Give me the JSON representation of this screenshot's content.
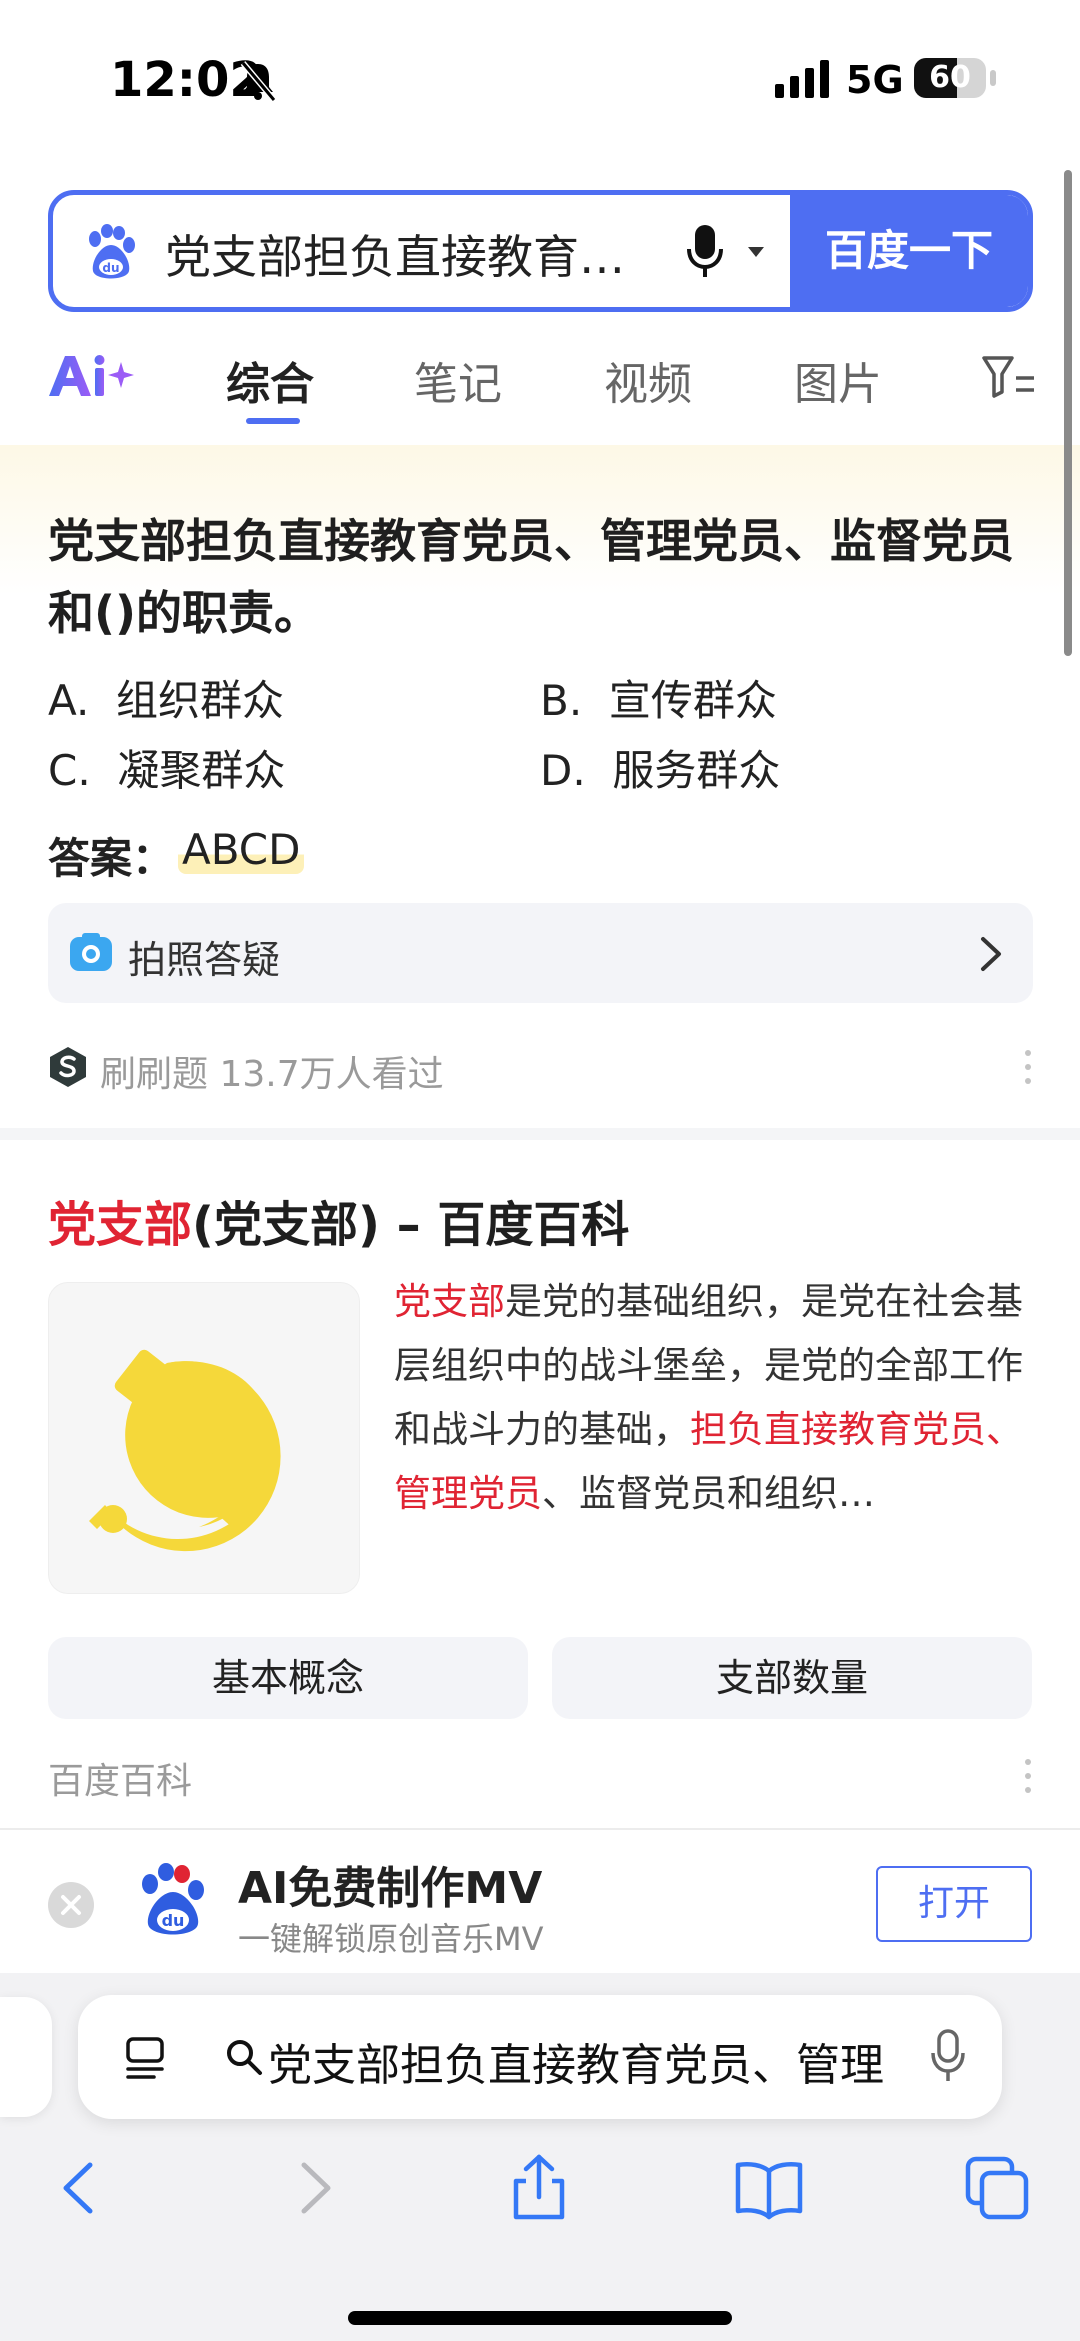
{
  "status_bar": {
    "time": "12:02",
    "network": "5G",
    "battery": "60",
    "battery_level_percent": 60
  },
  "search": {
    "query": "党支部担负直接教育…",
    "button_label": "百度一下"
  },
  "tabs": [
    {
      "label": "综合",
      "active": true
    },
    {
      "label": "笔记",
      "active": false
    },
    {
      "label": "视频",
      "active": false
    },
    {
      "label": "图片",
      "active": false
    }
  ],
  "answer_card": {
    "question": "党支部担负直接教育党员、管理党员、监督党员和()的职责。",
    "options": [
      {
        "letter": "A.",
        "text": "组织群众"
      },
      {
        "letter": "B.",
        "text": "宣传群众"
      },
      {
        "letter": "C.",
        "text": "凝聚群众"
      },
      {
        "letter": "D.",
        "text": "服务群众"
      }
    ],
    "answer_label": "答案：",
    "answer_value": "ABCD",
    "photo_qa_label": "拍照答疑",
    "source": "刷刷题 13.7万人看过"
  },
  "baike_card": {
    "title_highlight": "党支部",
    "title_rest": "(党支部) – 百度百科",
    "desc_highlight_1": "党支部",
    "desc_text_1": "是党的基础组织，是党在社会基层组织中的战斗堡垒，是党的全部工作和战斗力的基础，",
    "desc_highlight_2": "担负直接教育党员、管理党员",
    "desc_text_2": "、监督党员和组织…",
    "chips": [
      "基本概念",
      "支部数量"
    ],
    "source": "百度百科"
  },
  "app_banner": {
    "title": "AI免费制作MV",
    "subtitle": "一键解锁原创音乐MV",
    "open_label": "打开"
  },
  "safari": {
    "address_text": "党支部担负直接教育党员、管理"
  },
  "colors": {
    "accent": "#4e6ef2",
    "highlight_red": "#e02433",
    "emblem_yellow": "#f5d83a"
  }
}
